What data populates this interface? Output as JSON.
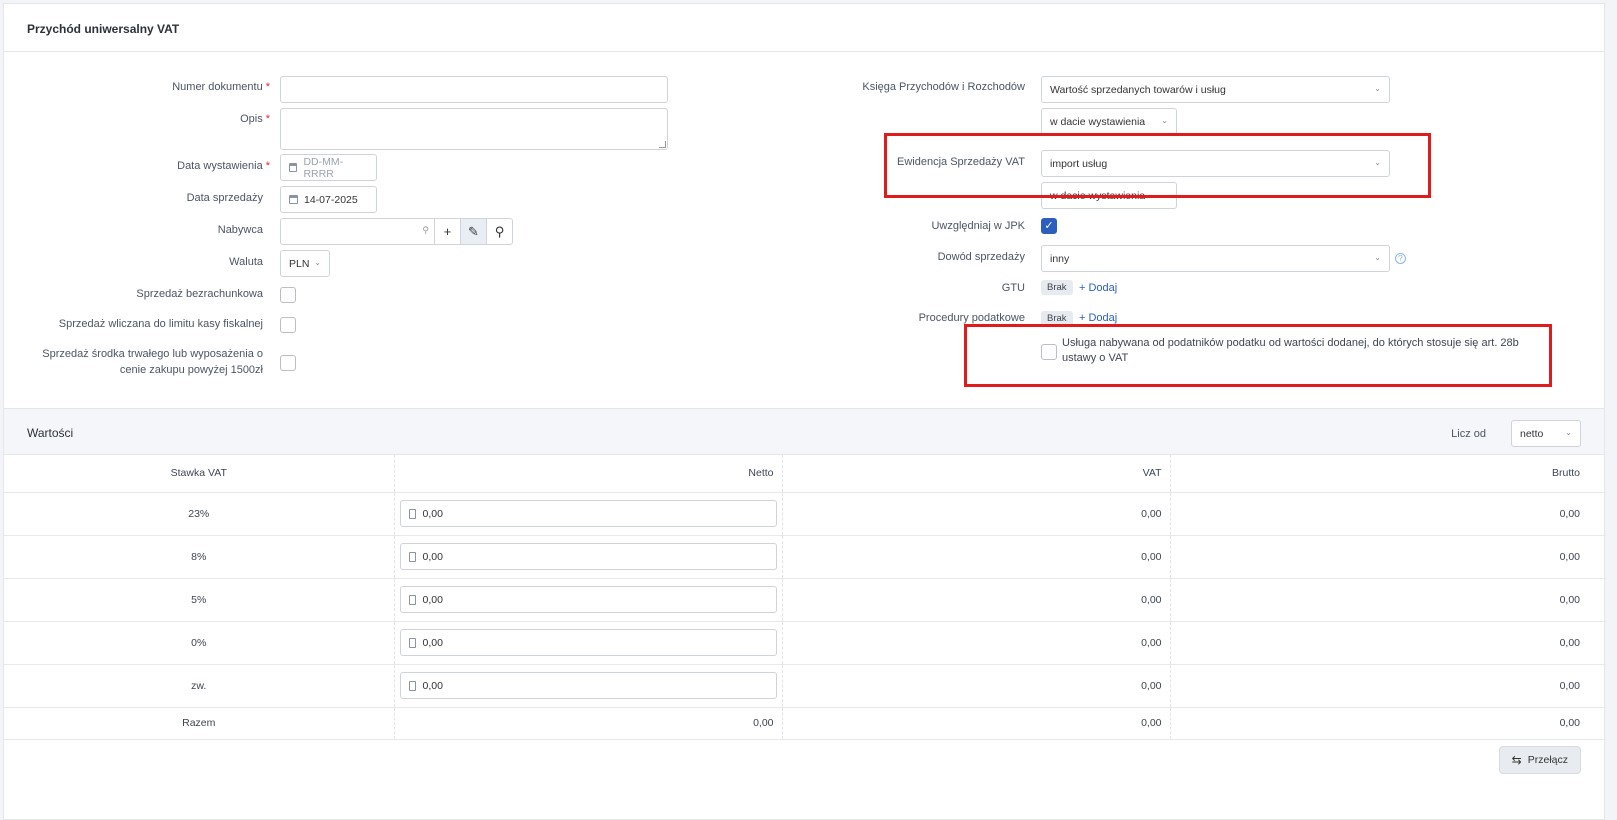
{
  "header": {
    "title": "Przychód uniwersalny VAT"
  },
  "left": {
    "numer_dokumentu": {
      "label": "Numer dokumentu",
      "value": ""
    },
    "opis": {
      "label": "Opis",
      "value": ""
    },
    "data_wystawienia": {
      "label": "Data wystawienia",
      "placeholder": "DD-MM-RRRR"
    },
    "data_sprzedazy": {
      "label": "Data sprzedaży",
      "value": "14-07-2025"
    },
    "nabywca": {
      "label": "Nabywca",
      "value": ""
    },
    "waluta": {
      "label": "Waluta",
      "value": "PLN"
    },
    "sprzedaz_bezrachunkowa": {
      "label": "Sprzedaż bezrachunkowa"
    },
    "limit_kasy": {
      "label": "Sprzedaż wliczana do limitu kasy fiskalnej"
    },
    "srodek_trwaly": {
      "label": "Sprzedaż środka trwałego lub wyposażenia o cenie zakupu powyżej 1500zł"
    }
  },
  "right": {
    "kpir": {
      "label": "Księga Przychodów i Rozchodów",
      "value": "Wartość sprzedanych towarów i usług",
      "date_value": "w dacie wystawienia"
    },
    "ewidencja": {
      "label": "Ewidencja Sprzedaży VAT",
      "value": "import usług",
      "date_value": "w dacie wystawienia"
    },
    "jpk": {
      "label": "Uwzględniaj w JPK",
      "checked": true
    },
    "dowod": {
      "label": "Dowód sprzedaży",
      "value": "inny"
    },
    "gtu": {
      "label": "GTU",
      "badge": "Brak",
      "add": "+ Dodaj"
    },
    "procedury": {
      "label": "Procedury podatkowe",
      "badge": "Brak",
      "add": "+ Dodaj"
    },
    "art28b": {
      "label": "Usługa nabywana od podatników podatku od wartości dodanej, do których stosuje się art. 28b ustawy o VAT"
    }
  },
  "values": {
    "title": "Wartości",
    "licz_od_label": "Licz od",
    "licz_od_value": "netto",
    "columns": [
      "Stawka VAT",
      "Netto",
      "VAT",
      "Brutto"
    ],
    "rows": [
      {
        "rate": "23%",
        "netto": "0,00",
        "vat": "0,00",
        "brutto": "0,00"
      },
      {
        "rate": "8%",
        "netto": "0,00",
        "vat": "0,00",
        "brutto": "0,00"
      },
      {
        "rate": "5%",
        "netto": "0,00",
        "vat": "0,00",
        "brutto": "0,00"
      },
      {
        "rate": "0%",
        "netto": "0,00",
        "vat": "0,00",
        "brutto": "0,00"
      },
      {
        "rate": "zw.",
        "netto": "0,00",
        "vat": "0,00",
        "brutto": "0,00"
      }
    ],
    "total": {
      "label": "Razem",
      "netto": "0,00",
      "vat": "0,00",
      "brutto": "0,00"
    },
    "switch_label": "Przełącz"
  },
  "colors": {
    "accent": "#2c5fbd",
    "highlight": "#e01b1b",
    "required": "#d32f2f"
  }
}
